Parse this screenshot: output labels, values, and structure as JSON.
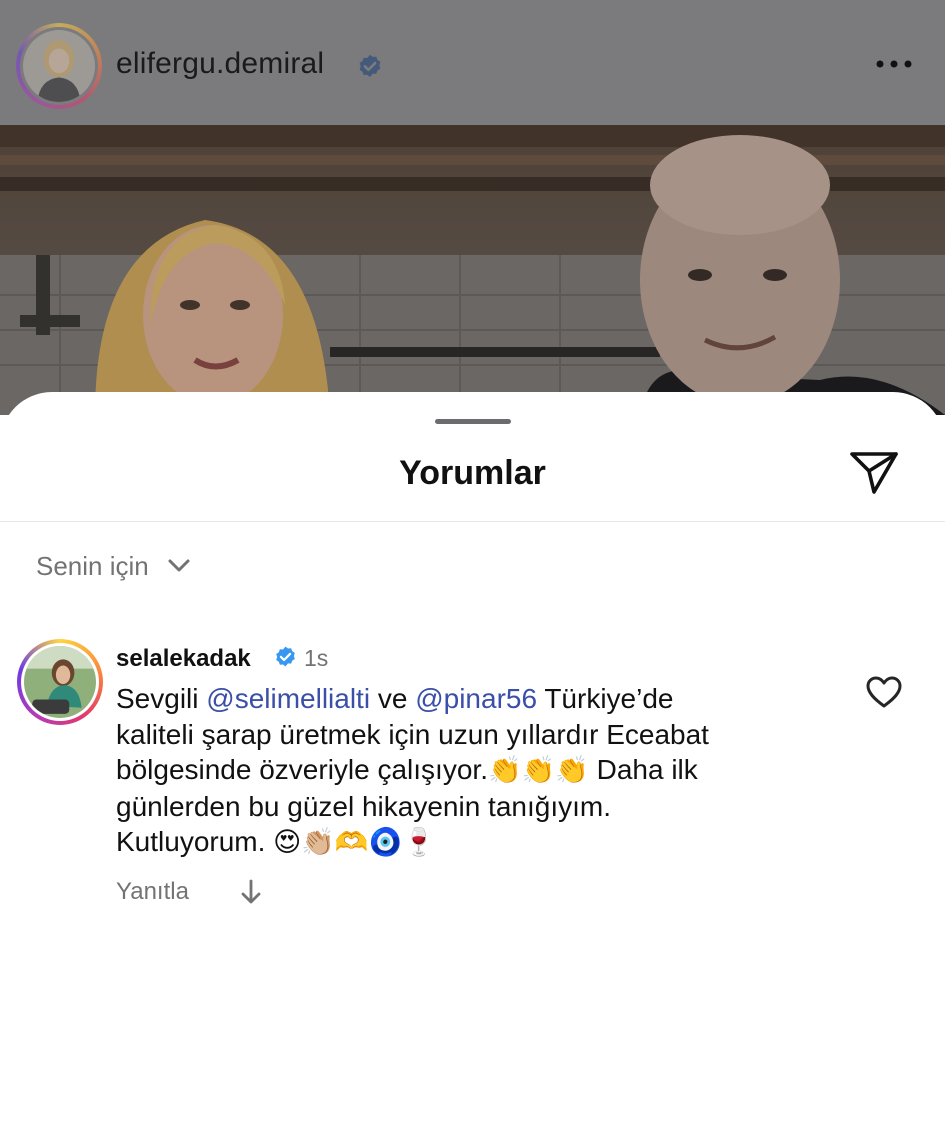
{
  "post": {
    "username": "elifergu.demiral",
    "verified": true,
    "more_icon": "more-horizontal-icon"
  },
  "comments_sheet": {
    "title": "Yorumlar",
    "share_icon": "send-icon",
    "sort": {
      "label": "Senin için",
      "icon": "chevron-down-icon"
    }
  },
  "comment": {
    "username": "selalekadak",
    "verified": true,
    "time": "1s",
    "lines": [
      [
        "Sevgili ",
        "@selimellialti",
        " ve ",
        "@pinar56",
        " Türkiye’de"
      ],
      [
        "kaliteli şarap üretmek için uzun yıllardır Eceabat"
      ],
      [
        "bölgesinde özveriyle çalışıyor.",
        "👏👏👏",
        " Daha ilk"
      ],
      [
        "günlerden bu güzel hikayenin tanığıyım."
      ],
      [
        "Kutluyorum. ",
        "😍👏🏼🫶🧿🍷"
      ]
    ],
    "mentions": [
      "@selimellialti",
      "@pinar56"
    ],
    "reply_label": "Yanıtla",
    "like_icon": "heart-outline-icon"
  },
  "colors": {
    "mention": "#3a4fa8",
    "verified_badge": "#3897f0",
    "secondary_text": "#737373"
  }
}
